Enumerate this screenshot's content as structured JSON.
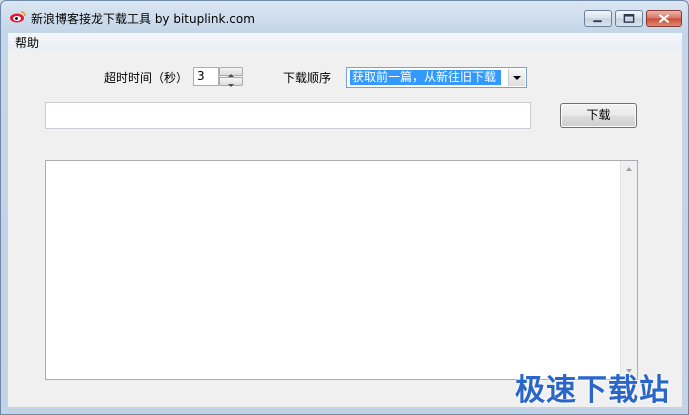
{
  "window": {
    "title": "新浪博客接龙下载工具 by bituplink.com",
    "icon": "sina-weibo-icon"
  },
  "titlebar_buttons": {
    "minimize_icon": "minimize-icon",
    "maximize_icon": "maximize-icon",
    "close_icon": "close-icon"
  },
  "menu": {
    "items": [
      {
        "label": "帮助"
      }
    ]
  },
  "form": {
    "timeout_label": "超时时间（秒）",
    "timeout_value": "3",
    "order_label": "下载顺序",
    "order_selected": "获取前一篇，从新往旧下载",
    "url_value": "",
    "download_label": "下载"
  },
  "log": {
    "content": ""
  },
  "watermark": {
    "text": "极速下载站"
  },
  "colors": {
    "selection": "#3399ff",
    "watermark": "#2a66c8",
    "close_button": "#c94a36"
  }
}
